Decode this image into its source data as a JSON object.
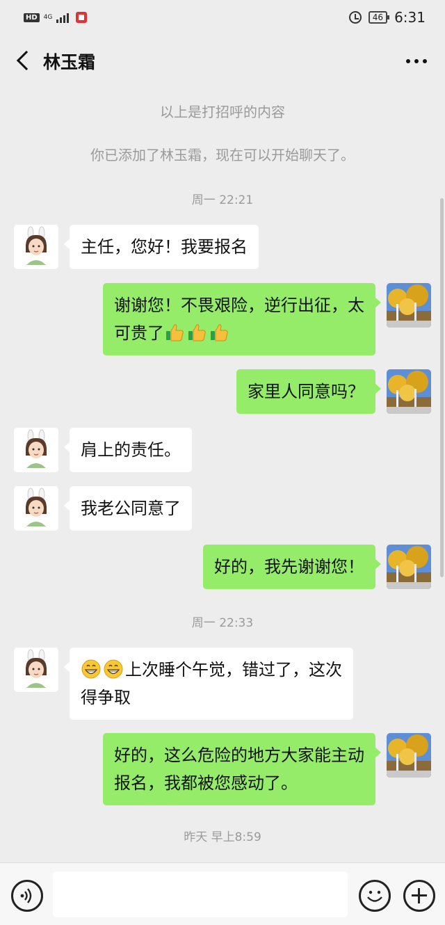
{
  "status_bar": {
    "hd_label": "HD",
    "network_label": "4G",
    "battery_level": "46",
    "time": "6:31"
  },
  "header": {
    "title": "林玉霜"
  },
  "system_messages": [
    "以上是打招呼的内容",
    "你已添加了林玉霜，现在可以开始聊天了。"
  ],
  "time_labels": [
    "周一 22:21",
    "周一 22:33",
    "昨天 早上8:59"
  ],
  "messages": [
    {
      "from": "contact",
      "text": "主任，您好！我要报名"
    },
    {
      "from": "me",
      "line1": "谢谢您！不畏艰险，逆行出征，太",
      "line2": "可贵了"
    },
    {
      "from": "me",
      "text": "家里人同意吗？"
    },
    {
      "from": "contact",
      "text": "肩上的责任。"
    },
    {
      "from": "contact",
      "text": "我老公同意了"
    },
    {
      "from": "me",
      "text": "好的，我先谢谢您！"
    },
    {
      "from": "contact",
      "line1": "上次睡个午觉，错过了，这次",
      "line2": "得争取"
    },
    {
      "from": "me",
      "line1": "好的，这么危险的地方大家能主动",
      "line2": "报名，我都被您感动了。"
    }
  ],
  "input": {
    "placeholder": ""
  },
  "colors": {
    "background": "#ededed",
    "outgoing_bubble": "#95ec69",
    "incoming_bubble": "#ffffff"
  }
}
